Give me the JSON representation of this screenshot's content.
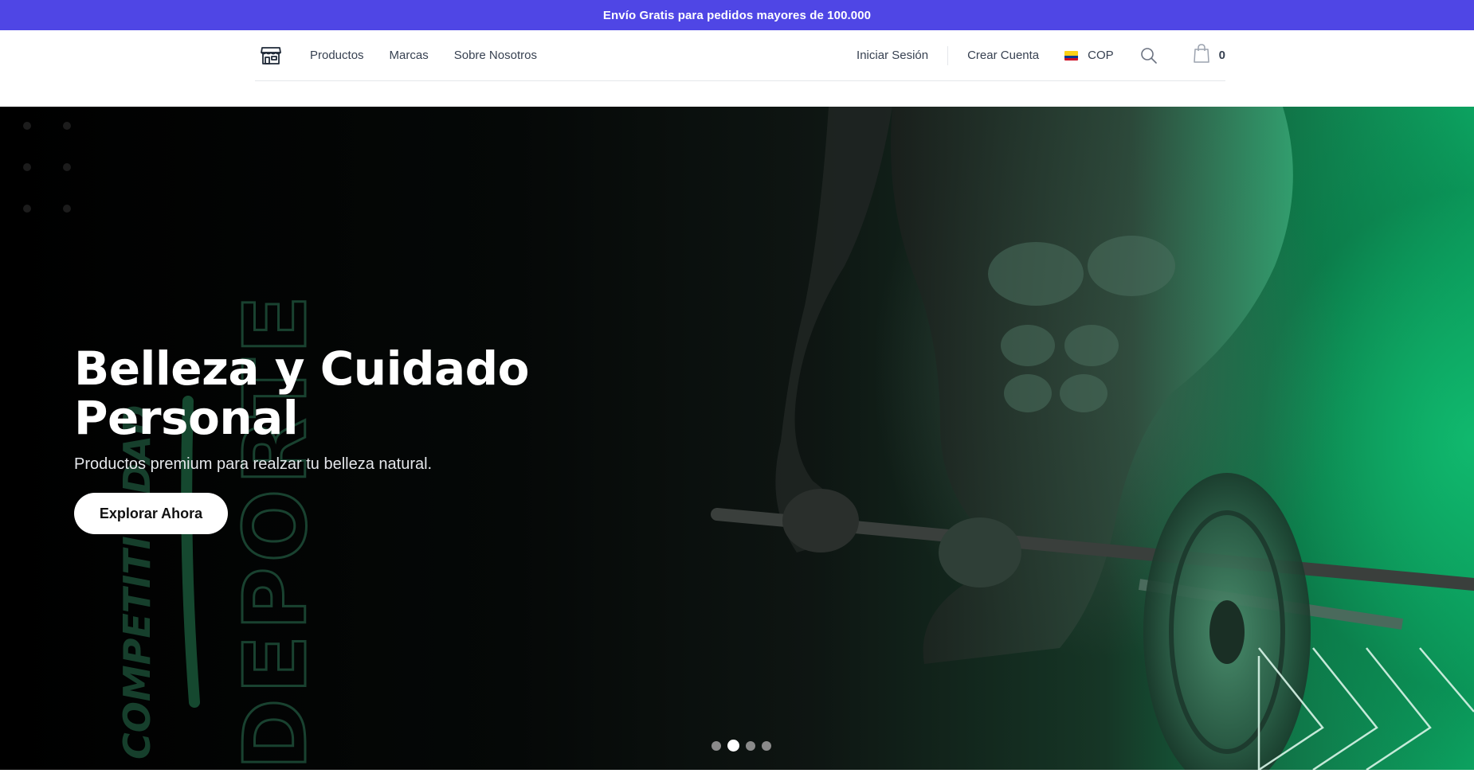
{
  "announcement": {
    "text": "Envío Gratis para pedidos mayores de 100.000"
  },
  "header": {
    "logo_icon": "store-icon",
    "nav": [
      {
        "label": "Productos"
      },
      {
        "label": "Marcas"
      },
      {
        "label": "Sobre Nosotros"
      }
    ],
    "login_label": "Iniciar Sesión",
    "register_label": "Crear Cuenta",
    "currency": {
      "label": "COP",
      "flag": "colombia-flag-icon"
    },
    "search_icon": "search-icon",
    "cart": {
      "icon": "shopping-bag-icon",
      "count": "0"
    }
  },
  "hero": {
    "title_line1": "Belleza y Cuidado",
    "title_line2": "Personal",
    "subtitle": "Productos premium para realzar tu belleza natural.",
    "cta_label": "Explorar Ahora",
    "background_text": "DEPORTE",
    "background_script": "COMPETITIVIDAD",
    "slides_total": 4,
    "active_slide": 2
  },
  "colors": {
    "announcement_bg": "#4f46e5",
    "accent_green": "#10b981",
    "text_dark": "#111111"
  }
}
